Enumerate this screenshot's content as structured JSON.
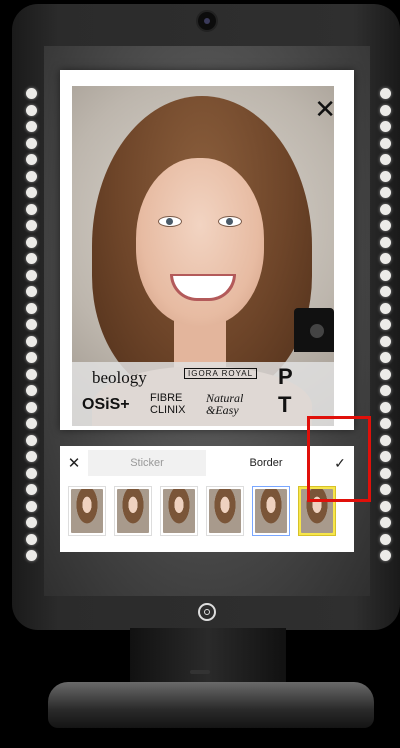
{
  "photo_card": {
    "close_glyph": "✕",
    "brands": {
      "beology": "beology",
      "igora_royal": "IGORA ROYAL",
      "osis": "OSiS+",
      "fibre_clinix_line1": "FIBRE",
      "fibre_clinix_line2": "CLINIX",
      "natural_easy_line1": "Natural",
      "natural_easy_line2": "&Easy",
      "pt_letters_p": "P",
      "pt_letters_t": "T"
    }
  },
  "editor": {
    "close_glyph": "✕",
    "tabs": [
      {
        "label": "Sticker",
        "active": false
      },
      {
        "label": "Border",
        "active": true
      }
    ],
    "confirm_glyph": "✓",
    "border_thumbnails": [
      {
        "style": "plain"
      },
      {
        "style": "plain"
      },
      {
        "style": "plain"
      },
      {
        "style": "plain"
      },
      {
        "style": "blue"
      },
      {
        "style": "yellow"
      }
    ]
  },
  "colors": {
    "highlight": "#e0100a",
    "led": "#ecebe8",
    "frame": "#2b2b2b"
  }
}
